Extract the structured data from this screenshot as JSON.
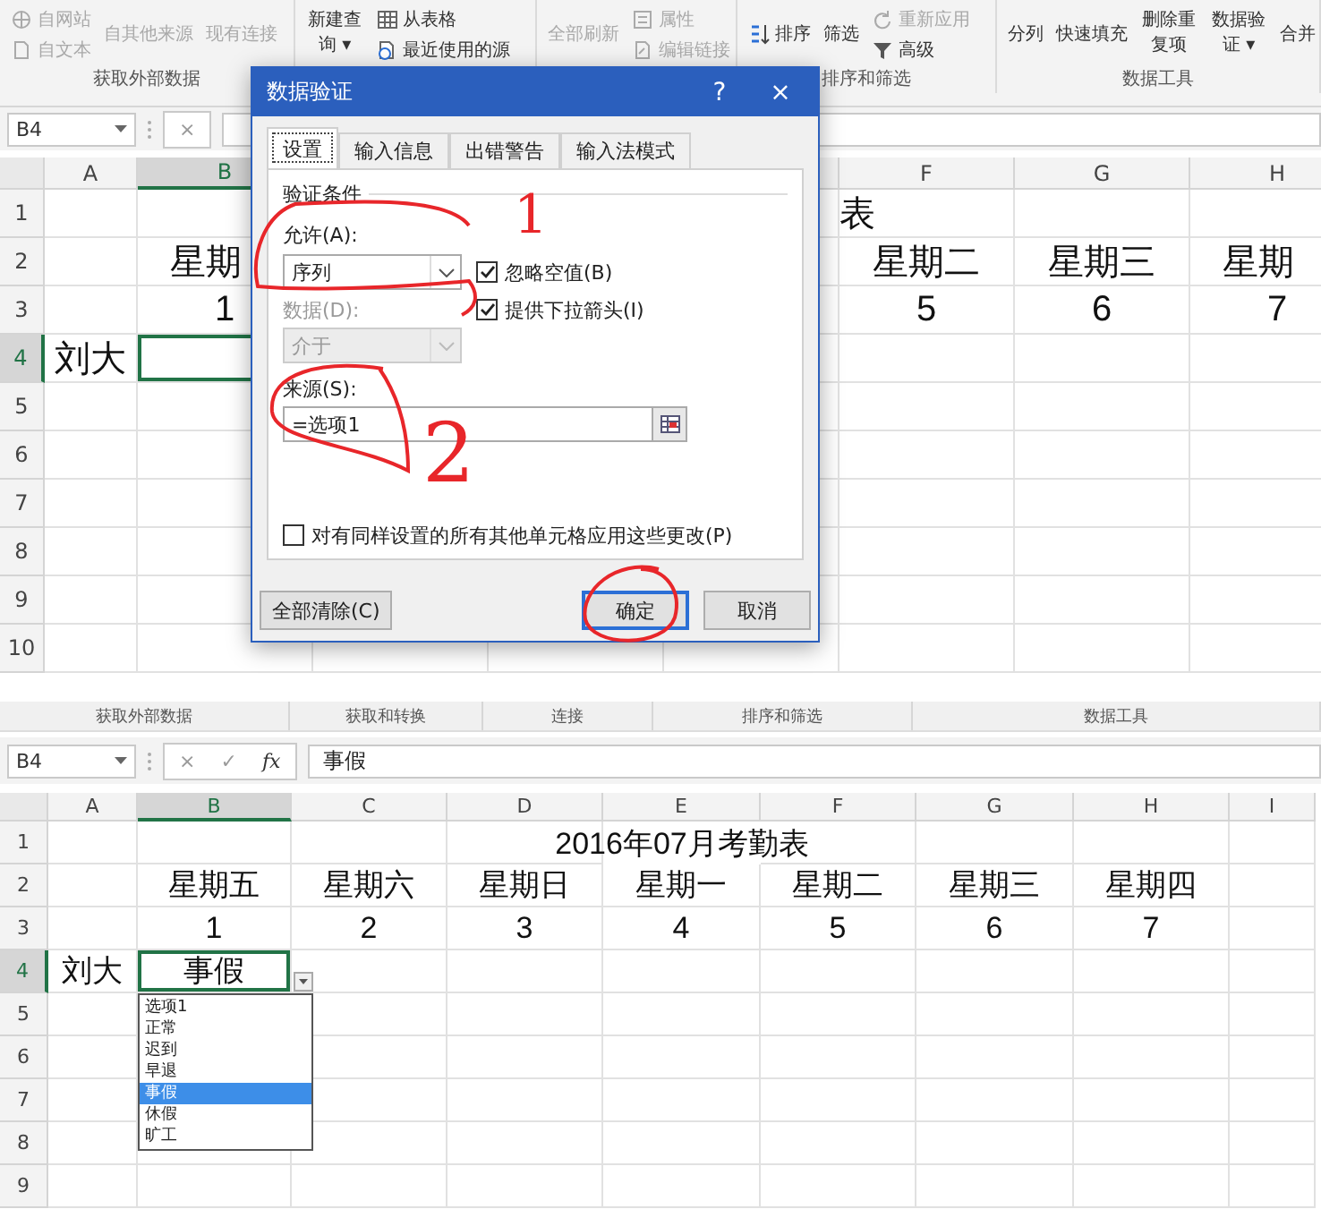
{
  "top": {
    "ribbon": {
      "groups": [
        {
          "label": "获取外部数据",
          "items": [
            {
              "label": "自网站",
              "kind": "small",
              "disabled": true
            },
            {
              "label": "自文本",
              "kind": "small",
              "disabled": true
            },
            {
              "label": "自其他来源",
              "kind": "tall",
              "disabled": true
            },
            {
              "label": "现有连接",
              "kind": "tall",
              "disabled": true
            }
          ]
        },
        {
          "items": [
            {
              "label": "新建查询 ▾",
              "kind": "stacked",
              "disabled": false
            },
            {
              "label": "从表格",
              "kind": "small",
              "disabled": false
            },
            {
              "label": "最近使用的源",
              "kind": "small",
              "disabled": false
            }
          ]
        },
        {
          "items": [
            {
              "label": "全部刷新",
              "kind": "tall",
              "disabled": true
            },
            {
              "label": "属性",
              "kind": "small",
              "disabled": true
            },
            {
              "label": "编辑链接",
              "kind": "small",
              "disabled": true
            }
          ]
        },
        {
          "label": "排序和筛选",
          "items": [
            {
              "label": "排序",
              "kind": "tall",
              "disabled": false
            },
            {
              "label": "筛选",
              "kind": "tall",
              "disabled": false
            },
            {
              "label": "重新应用",
              "kind": "small",
              "disabled": true
            },
            {
              "label": "高级",
              "kind": "small",
              "disabled": false
            }
          ]
        },
        {
          "label": "数据工具",
          "items": [
            {
              "label": "分列",
              "kind": "tall",
              "disabled": false
            },
            {
              "label": "快速填充",
              "kind": "tall",
              "disabled": false
            },
            {
              "label": "删除重复项",
              "kind": "stacked",
              "disabled": false
            },
            {
              "label": "数据验证 ▾",
              "kind": "stacked",
              "disabled": false
            },
            {
              "label": "合并",
              "kind": "tall",
              "disabled": false
            }
          ]
        }
      ]
    },
    "formula_bar": {
      "name_box": "B4",
      "buttons": [
        {
          "label": "×",
          "kind": "cancel"
        }
      ]
    },
    "sheet": {
      "columns": [
        "A",
        "B",
        null,
        null,
        null,
        "F",
        "G",
        "H"
      ],
      "rows": [
        {
          "header": "1",
          "cells": [
            null,
            null,
            null,
            null,
            null,
            {
              "text": "表",
              "kind": "edge"
            }
          ]
        },
        {
          "header": "2",
          "cells": [
            null,
            {
              "text": "星期",
              "kind": "start"
            },
            null,
            null,
            null,
            "星期二",
            "星期三",
            {
              "text": "星期",
              "kind": "start"
            }
          ]
        },
        {
          "header": "3",
          "cells": [
            null,
            "1",
            null,
            null,
            null,
            "5",
            "6",
            "7"
          ]
        },
        {
          "header": "4",
          "cells": [
            "刘大",
            {
              "selected": true
            }
          ]
        },
        {
          "header": "5",
          "cells": []
        },
        {
          "header": "6",
          "cells": []
        },
        {
          "header": "7",
          "cells": []
        },
        {
          "header": "8",
          "cells": []
        },
        {
          "header": "9",
          "cells": []
        },
        {
          "header": "10",
          "cells": []
        }
      ]
    },
    "dialog": {
      "title": "数据验证",
      "help": "?",
      "close": "×",
      "tabs": [
        {
          "label": "设置",
          "selected": true
        },
        {
          "label": "输入信息",
          "selected": false
        },
        {
          "label": "出错警告",
          "selected": false
        },
        {
          "label": "输入法模式",
          "selected": false
        }
      ],
      "section": "验证条件",
      "allow": {
        "label": "允许(A):",
        "value": "序列",
        "disabled": false
      },
      "data": {
        "label": "数据(D):",
        "value": "介于",
        "disabled": true
      },
      "checkboxes": [
        {
          "label": "忽略空值(B)",
          "checked": true
        },
        {
          "label": "提供下拉箭头(I)",
          "checked": true
        }
      ],
      "source": {
        "label": "来源(S):",
        "value": "=选项1"
      },
      "apply_all": {
        "label": "对有同样设置的所有其他单元格应用这些更改(P)",
        "checked": false
      },
      "buttons": [
        {
          "label": "全部清除(C)",
          "kind": "normal"
        },
        {
          "label": "确定",
          "kind": "default"
        },
        {
          "label": "取消",
          "kind": "normal"
        }
      ]
    },
    "annotations": [
      "1",
      "2"
    ]
  },
  "bottom": {
    "group_labels": [
      "获取外部数据",
      "获取和转换",
      "连接",
      "排序和筛选",
      "数据工具"
    ],
    "formula_bar": {
      "name_box": "B4",
      "buttons": [
        {
          "label": "×",
          "kind": "cancel"
        },
        {
          "label": "✓",
          "kind": "enter"
        },
        {
          "label": "fx",
          "kind": "function"
        }
      ],
      "value": "事假"
    },
    "sheet": {
      "columns": [
        "A",
        "B",
        "C",
        "D",
        "E",
        "F",
        "G",
        "H",
        "I"
      ],
      "rows": [
        {
          "header": "1",
          "cells": [
            null,
            null,
            null,
            null,
            {
              "text": "2016年07月考勤表",
              "kind": "overflow"
            }
          ]
        },
        {
          "header": "2",
          "cells": [
            null,
            "星期五",
            "星期六",
            "星期日",
            "星期一",
            "星期二",
            "星期三",
            "星期四"
          ]
        },
        {
          "header": "3",
          "cells": [
            null,
            "1",
            "2",
            "3",
            "4",
            "5",
            "6",
            "7"
          ]
        },
        {
          "header": "4",
          "cells": [
            "刘大",
            {
              "text": "事假",
              "selected": true
            }
          ]
        },
        {
          "header": "5",
          "cells": []
        },
        {
          "header": "6",
          "cells": []
        },
        {
          "header": "7",
          "cells": []
        },
        {
          "header": "8",
          "cells": []
        },
        {
          "header": "9",
          "cells": []
        }
      ],
      "dropdown": {
        "items": [
          {
            "label": "选项1",
            "selected": false
          },
          {
            "label": "正常",
            "selected": false
          },
          {
            "label": "迟到",
            "selected": false
          },
          {
            "label": "早退",
            "selected": false
          },
          {
            "label": "事假",
            "selected": true
          },
          {
            "label": "休假",
            "selected": false
          },
          {
            "label": "旷工",
            "selected": false
          }
        ]
      }
    }
  }
}
